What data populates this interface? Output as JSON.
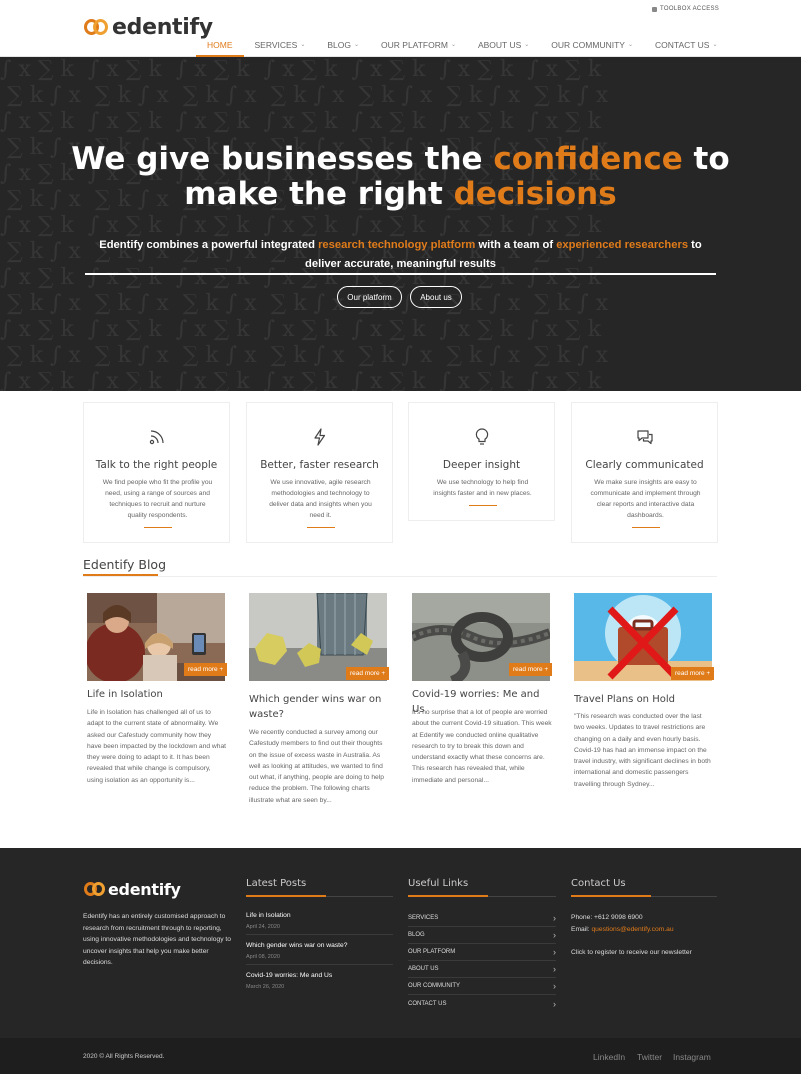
{
  "header": {
    "logo_text": "edentify",
    "toolbox_label": "TOOLBOX ACCESS",
    "nav": [
      {
        "label": "HOME"
      },
      {
        "label": "SERVICES"
      },
      {
        "label": "BLOG"
      },
      {
        "label": "OUR PLATFORM"
      },
      {
        "label": "ABOUT US"
      },
      {
        "label": "OUR COMMUNITY"
      },
      {
        "label": "CONTACT US"
      }
    ]
  },
  "hero": {
    "title_1": "We give businesses the ",
    "title_accent_1": "confidence",
    "title_2": " to",
    "title_3": "make the right ",
    "title_accent_2": "decisions",
    "sub_1": "Edentify combines a powerful integrated ",
    "sub_accent_1": "research technology platform",
    "sub_2": " with a team of ",
    "sub_accent_2": "experienced researchers",
    "sub_3": " to deliver accurate, meaningful results",
    "btn_platform": "Our platform",
    "btn_about": "About us"
  },
  "features": [
    {
      "icon": "rss-icon",
      "title": "Talk to the right people",
      "text": "We find people who fit the profile you need, using a range of sources and techniques to recruit and nurture quality respondents."
    },
    {
      "icon": "lightning-icon",
      "title": "Better, faster research",
      "text": "We use innovative, agile research methodologies and technology to deliver data and insights when you need it."
    },
    {
      "icon": "lightbulb-icon",
      "title": "Deeper insight",
      "text": "We use technology to help find insights faster and in new places."
    },
    {
      "icon": "chat-icon",
      "title": "Clearly communicated",
      "text": "We make sure insights are easy to communicate and implement through clear reports and interactive data dashboards."
    }
  ],
  "blog": {
    "heading": "Edentify Blog",
    "read_more": "read more +",
    "posts": [
      {
        "title": "Life in Isolation",
        "text": "Life in Isolation has challenged all of us to adapt to the current state of abnormality. We asked our Cafestudy community how they have been impacted by the lockdown and what they were doing to adapt to it. It has been revealed that while change is compulsory, using isolation as an opportunity is..."
      },
      {
        "title": "Which gender wins war on waste?",
        "text": "We recently conducted a survey among our Cafestudy members to find out their thoughts on the issue of excess waste in Australia. As well as looking at attitudes, we wanted to find out what, if anything, people are doing to help reduce the problem. The following charts illustrate what are seen by..."
      },
      {
        "title": "Covid-19 worries: Me and Us",
        "text": "It's no surprise that a lot of people are worried about the current Covid-19 situation. This week at Edentify we conducted online qualitative research to try to break this down and understand exactly what these concerns are. This research has revealed that, while immediate and personal..."
      },
      {
        "title": "Travel Plans on Hold",
        "text": "\"This research was conducted over the last two weeks. Updates to travel restrictions are changing on a daily and even hourly basis. Covid-19 has had an immense impact on the travel industry, with significant declines in both international and domestic passengers travelling through Sydney..."
      }
    ]
  },
  "footer": {
    "logo_text": "edentify",
    "about": "Edentify has an entirely customised approach to research from recruitment through to reporting, using innovative methodologies and technology to uncover insights that help you make better decisions.",
    "latest_heading": "Latest Posts",
    "latest": [
      {
        "title": "Life in Isolation",
        "date": "April 24, 2020"
      },
      {
        "title": "Which gender wins war on waste?",
        "date": "April 08, 2020"
      },
      {
        "title": "Covid-19 worries: Me and Us",
        "date": "March 26, 2020"
      }
    ],
    "links_heading": "Useful Links",
    "links": [
      "SERVICES",
      "BLOG",
      "OUR PLATFORM",
      "ABOUT US",
      "OUR COMMUNITY",
      "CONTACT US"
    ],
    "contact_heading": "Contact Us",
    "phone_label": "Phone: +612 9098 6900",
    "email_label": "Email: ",
    "email": "questions@edentify.com.au",
    "newsletter": "Click to register to receive our newsletter",
    "copyright": "2020 © All Rights Reserved.",
    "social": [
      "LinkedIn",
      "Twitter",
      "Instagram"
    ]
  },
  "colors": {
    "accent": "#e07b1a",
    "dark": "#262626"
  }
}
